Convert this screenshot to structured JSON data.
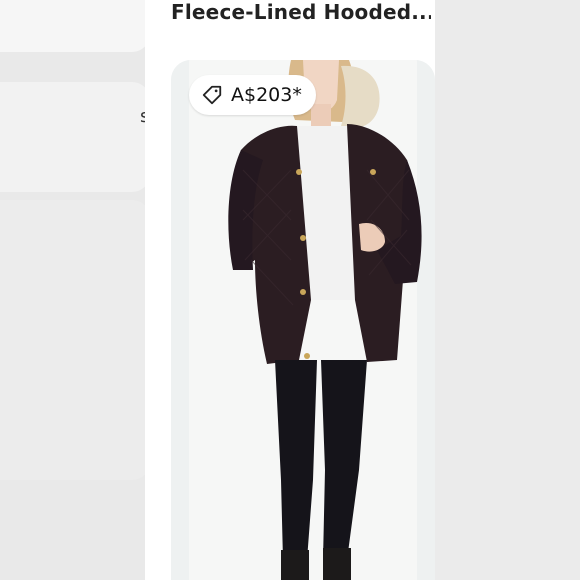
{
  "product": {
    "title": "Fleece-Lined Hooded...",
    "price": "A$203*"
  },
  "peek": {
    "left_char": "s"
  },
  "icons": {
    "price_tag": "tag-icon"
  },
  "colors": {
    "jacket": "#2b1d22",
    "card_bg": "#eef1f1",
    "gutter": "#e9e9e9"
  }
}
